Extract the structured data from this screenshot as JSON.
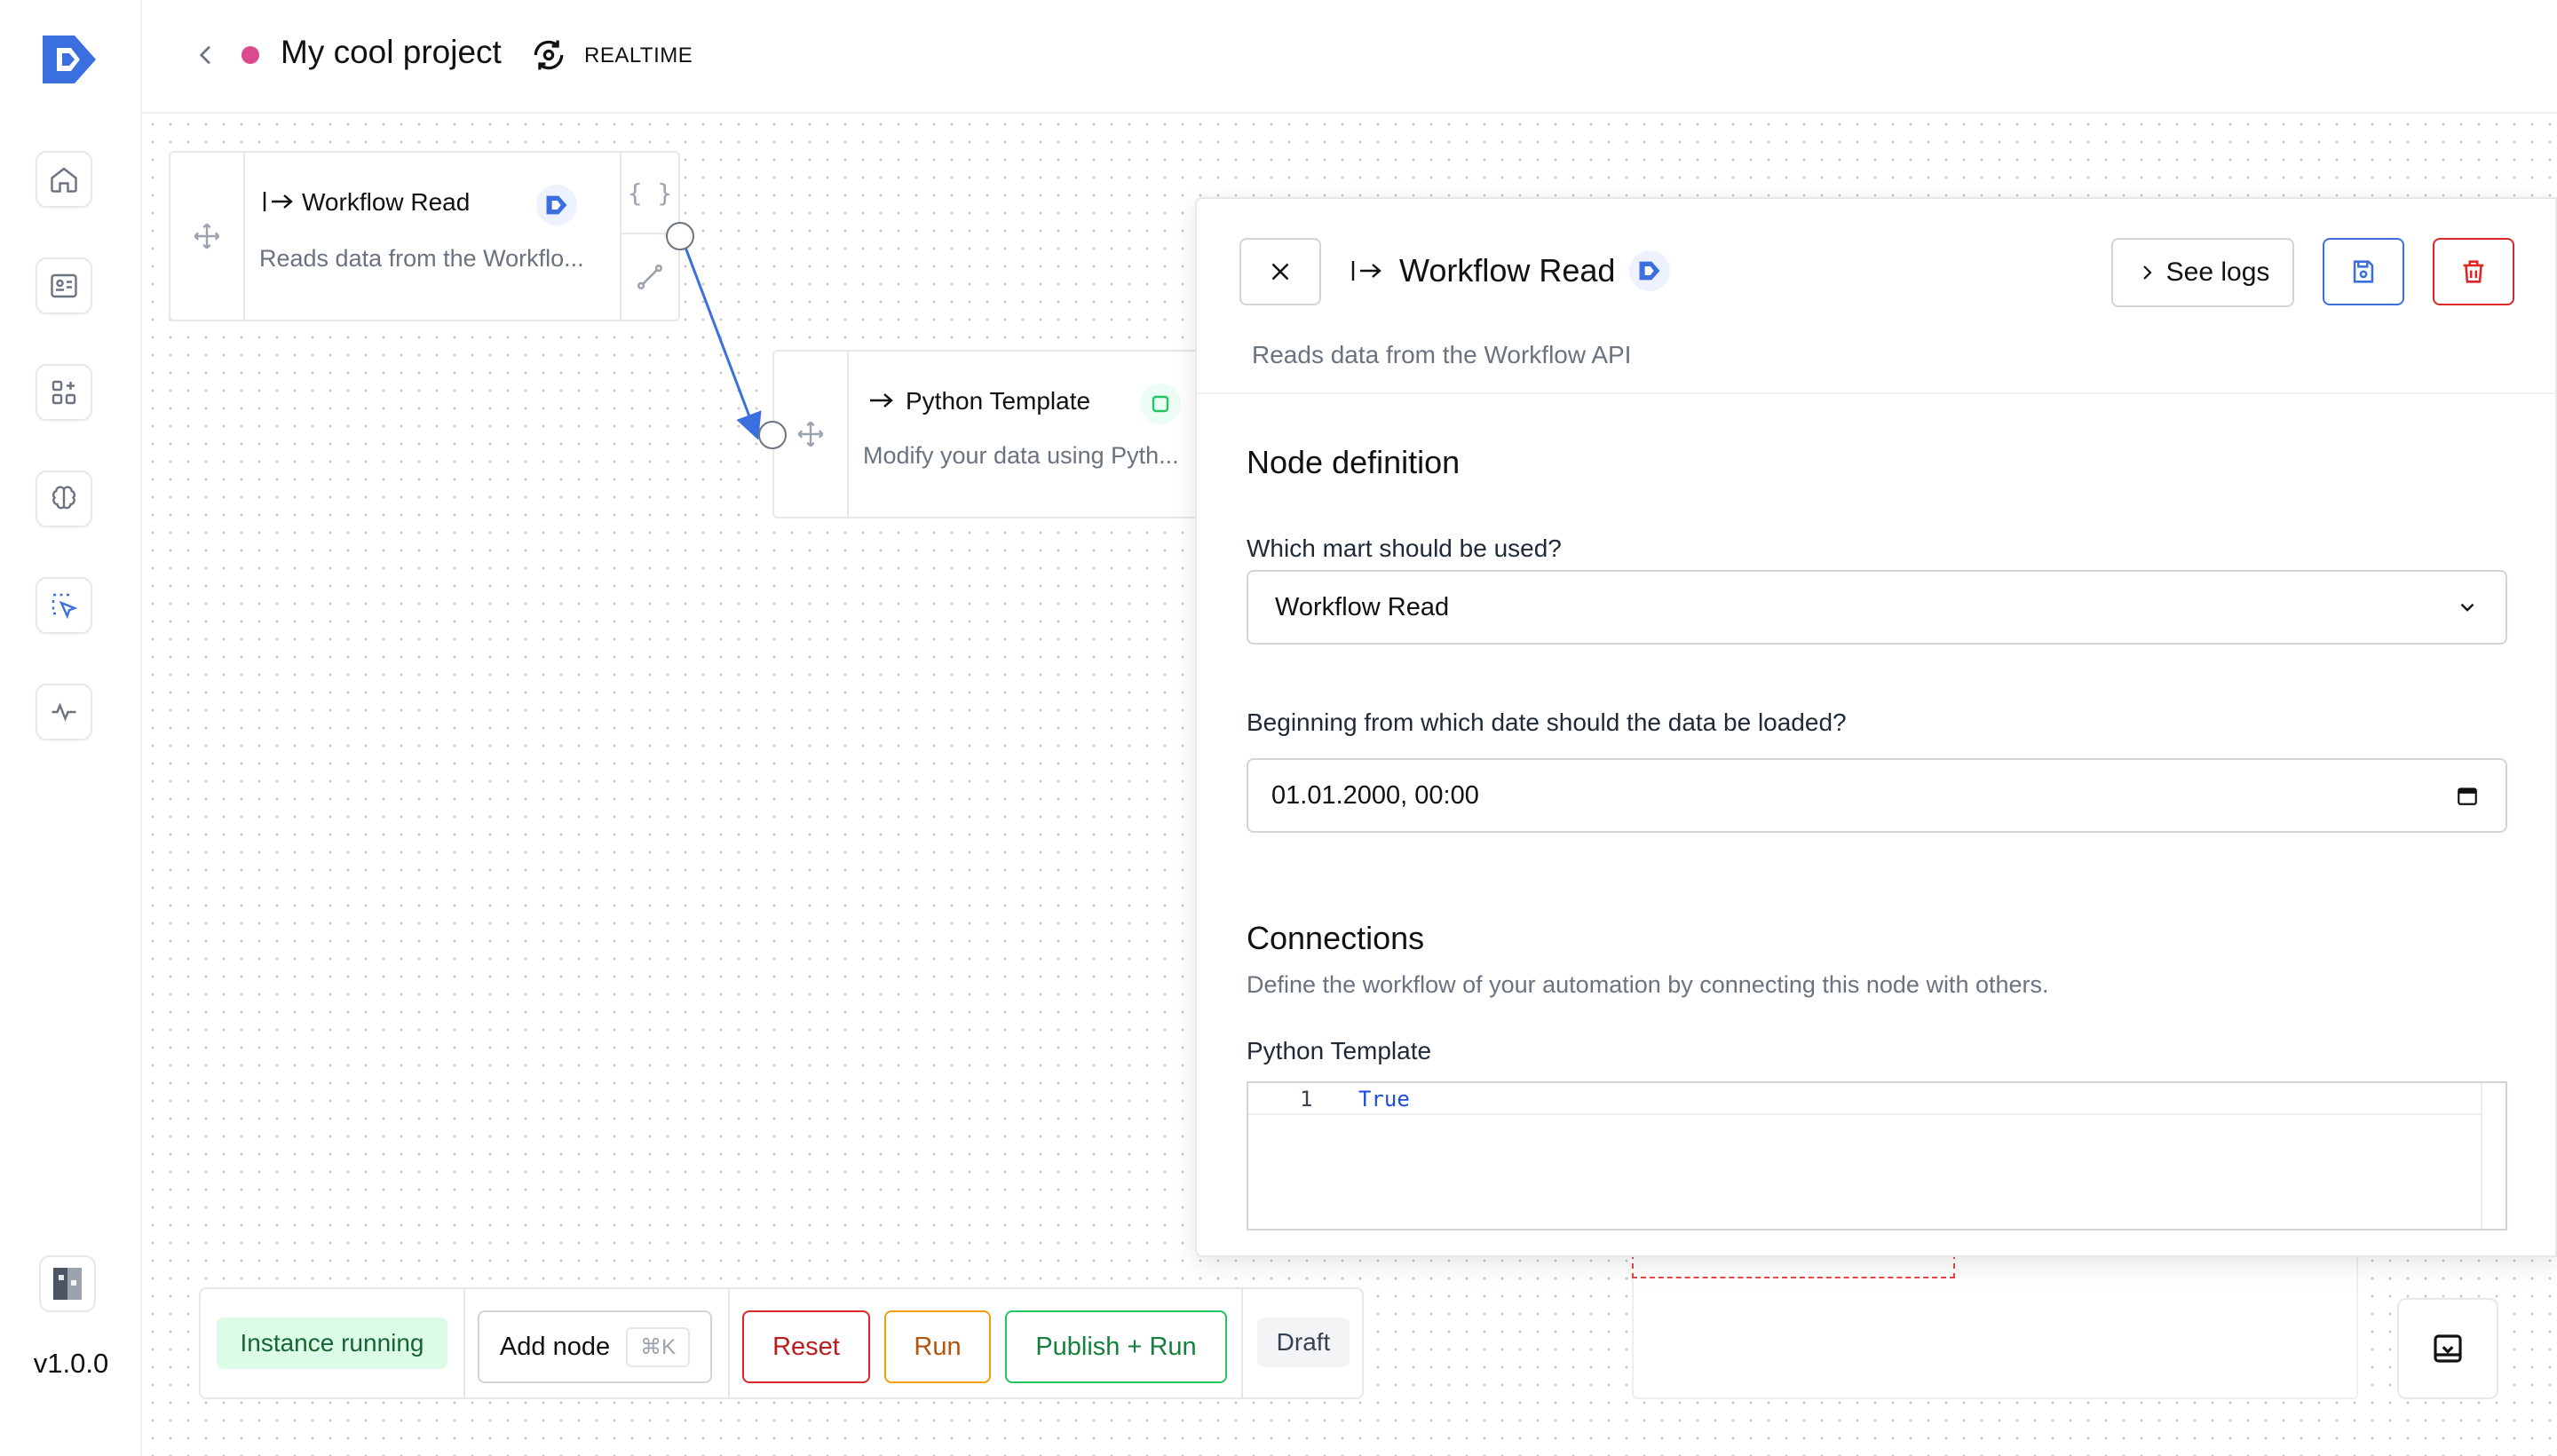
{
  "app": {
    "version": "v1.0.0",
    "accent": "#3b6fe0"
  },
  "sidebar": {
    "items": [
      {
        "name": "home",
        "icon": "home-icon"
      },
      {
        "name": "contacts",
        "icon": "id-card-icon"
      },
      {
        "name": "apps",
        "icon": "grid-plus-icon"
      },
      {
        "name": "brain",
        "icon": "brain-icon"
      },
      {
        "name": "workflows",
        "icon": "select-pointer-icon",
        "active": true
      },
      {
        "name": "activity",
        "icon": "activity-icon"
      }
    ]
  },
  "header": {
    "title": "My cool project",
    "status_color": "#db4a8c",
    "mode": "REALTIME"
  },
  "canvas": {
    "nodes": [
      {
        "title": "Workflow Read",
        "description": "Reads data from the Workflo...",
        "side_label": "{ }"
      },
      {
        "title": "Python Template",
        "description": "Modify your data using Pyth..."
      }
    ]
  },
  "toolbar": {
    "status": "Instance running",
    "add_node": "Add node",
    "shortcut": "⌘K",
    "reset": "Reset",
    "run": "Run",
    "publish": "Publish + Run",
    "draft": "Draft"
  },
  "panel": {
    "title": "Workflow Read",
    "see_logs": "See logs",
    "description": "Reads data from the Workflow API",
    "node_definition": "Node definition",
    "mart_label": "Which mart should be used?",
    "mart_value": "Workflow Read",
    "date_label": "Beginning from which date should the data be loaded?",
    "date_value": "01.01.2000, 00:00",
    "connections_title": "Connections",
    "connections_desc": "Define the workflow of your automation by connecting this node with others.",
    "connection_name": "Python Template",
    "code": {
      "line_number": "1",
      "text": "True"
    }
  }
}
